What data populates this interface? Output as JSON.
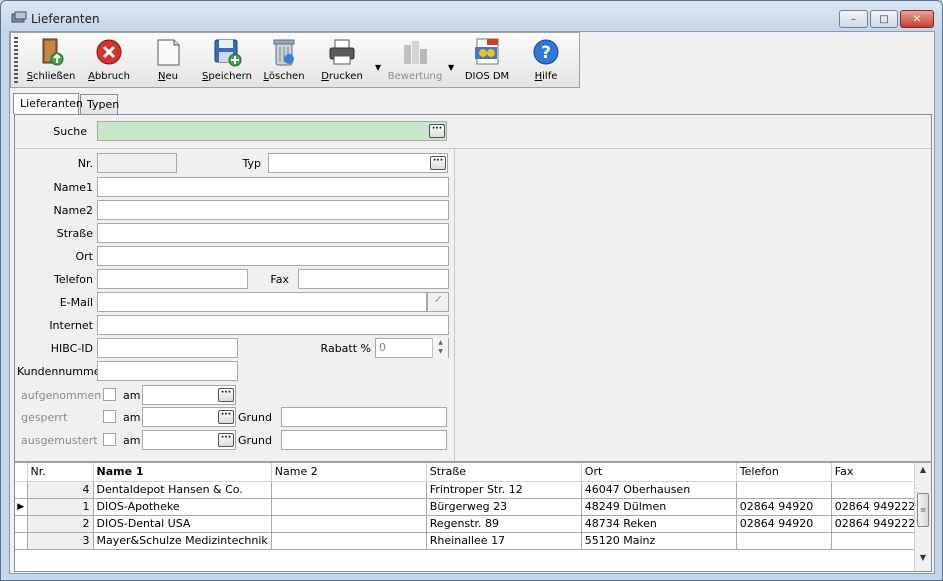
{
  "window": {
    "title": "Lieferanten",
    "buttons": {
      "minimize": "–",
      "maximize": "□",
      "close": "✕"
    }
  },
  "toolbar": {
    "items": [
      {
        "label": "Schließen",
        "u": "S",
        "rest": "chließen",
        "icon": "close-door-icon"
      },
      {
        "label": "Abbruch",
        "u": "A",
        "rest": "bbruch",
        "icon": "cancel-icon"
      },
      {
        "label": "Neu",
        "u": "N",
        "rest": "eu",
        "icon": "new-document-icon"
      },
      {
        "label": "Speichern",
        "u": "S",
        "rest": "peichern",
        "icon": "save-icon"
      },
      {
        "label": "Löschen",
        "u": "L",
        "rest": "öschen",
        "icon": "delete-icon"
      },
      {
        "label": "Drucken",
        "u": "D",
        "rest": "rucken",
        "icon": "printer-icon"
      },
      {
        "label": "Bewertung",
        "u": "",
        "rest": "Bewertung",
        "icon": "rating-icon",
        "disabled": true
      },
      {
        "label": "DIOS DM",
        "u": "",
        "rest": "DIOS DM",
        "icon": "dios-dm-icon"
      },
      {
        "label": "Hilfe",
        "u": "H",
        "rest": "ilfe",
        "icon": "help-icon"
      }
    ]
  },
  "tabs": [
    {
      "label": "Lieferanten",
      "active": true
    },
    {
      "label": "Typen",
      "active": false
    }
  ],
  "search": {
    "label": "Suche",
    "value": "",
    "button": "···"
  },
  "form": {
    "nr": {
      "label": "Nr.",
      "value": ""
    },
    "typ": {
      "label": "Typ",
      "value": ""
    },
    "name1": {
      "label": "Name1",
      "value": ""
    },
    "name2": {
      "label": "Name2",
      "value": ""
    },
    "strasse": {
      "label": "Straße",
      "value": ""
    },
    "ort": {
      "label": "Ort",
      "value": ""
    },
    "telefon": {
      "label": "Telefon",
      "value": ""
    },
    "fax": {
      "label": "Fax",
      "value": ""
    },
    "email": {
      "label": "E-Mail",
      "value": ""
    },
    "internet": {
      "label": "Internet",
      "value": ""
    },
    "hibc": {
      "label": "HIBC-ID",
      "value": ""
    },
    "rabatt": {
      "label": "Rabatt %",
      "value": "0"
    },
    "kundennummer": {
      "label": "Kundennummer",
      "value": ""
    },
    "aufgenommen": {
      "label": "aufgenommen",
      "am": "am"
    },
    "gesperrt": {
      "label": "gesperrt",
      "am": "am",
      "grund": "Grund"
    },
    "ausgemustert": {
      "label": "ausgemustert",
      "am": "am",
      "grund": "Grund"
    }
  },
  "grid": {
    "columns": [
      "Nr.",
      "Name 1",
      "Name 2",
      "Straße",
      "Ort",
      "Telefon",
      "Fax"
    ],
    "rows": [
      {
        "nr": "4",
        "name1": "Dentaldepot Hansen & Co.",
        "name2": "",
        "strasse": "Frintroper Str. 12",
        "ort": "46047 Oberhausen",
        "telefon": "",
        "fax": "",
        "current": false
      },
      {
        "nr": "1",
        "name1": "DIOS-Apotheke",
        "name2": "",
        "strasse": "Bürgerweg 23",
        "ort": "48249 Dülmen",
        "telefon": "02864 94920",
        "fax": "02864 949222",
        "current": true
      },
      {
        "nr": "2",
        "name1": "DIOS-Dental USA",
        "name2": "",
        "strasse": "Regenstr. 89",
        "ort": "48734 Reken",
        "telefon": "02864 94920",
        "fax": "02864 949222",
        "current": false
      },
      {
        "nr": "3",
        "name1": "Mayer&Schulze Medizintechnik",
        "name2": "",
        "strasse": "Rheinallee 17",
        "ort": "55120 Mainz",
        "telefon": "",
        "fax": "",
        "current": false
      }
    ]
  }
}
